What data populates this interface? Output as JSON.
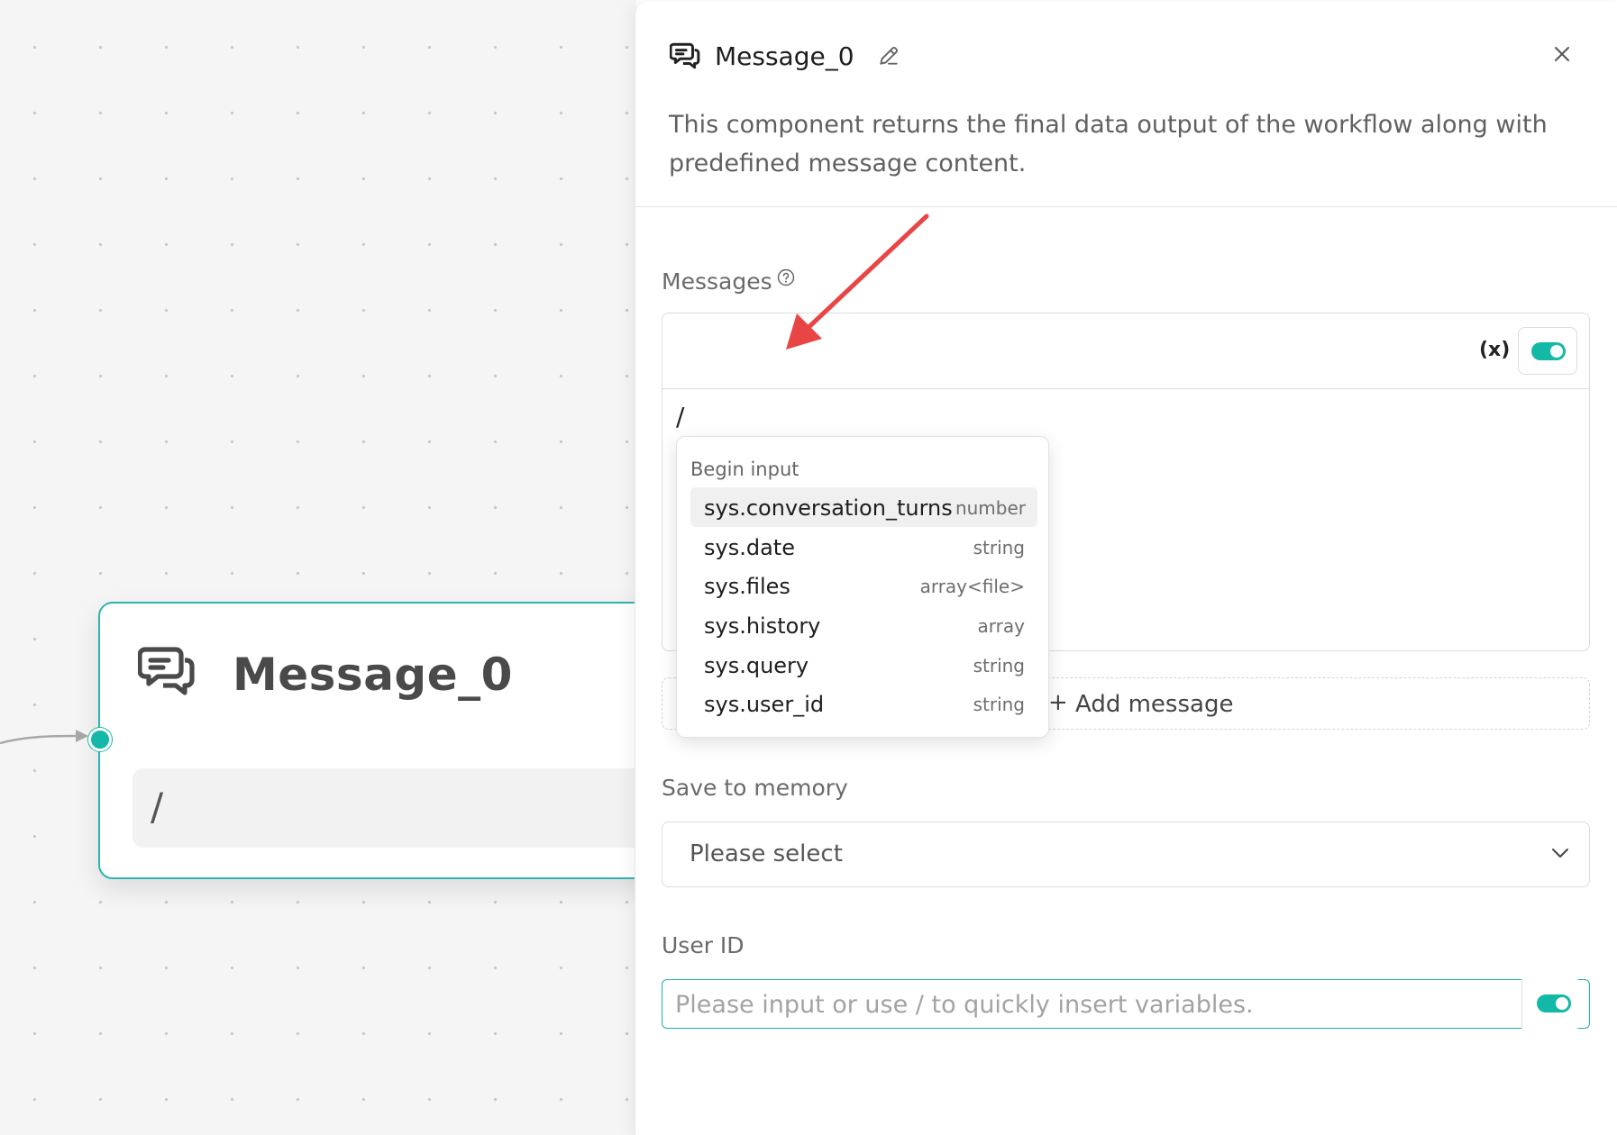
{
  "node": {
    "title": "Message_0",
    "content": "/"
  },
  "drawer": {
    "title": "Message_0",
    "description": "This component returns the final data output of the workflow along with predefined message content.",
    "messages": {
      "label": "Messages",
      "content": "/",
      "variable_icon": "(x)",
      "toggle_on": true
    },
    "add_message_label": "Add message",
    "save_to_memory": {
      "label": "Save to memory",
      "value": "Please select"
    },
    "user_id": {
      "label": "User ID",
      "placeholder": "Please input or use / to quickly insert variables.",
      "toggle_on": true
    }
  },
  "popover": {
    "group_label": "Begin input",
    "items": [
      {
        "name": "sys.conversation_turns",
        "type": "number",
        "active": true
      },
      {
        "name": "sys.date",
        "type": "string"
      },
      {
        "name": "sys.files",
        "type": "array<file>"
      },
      {
        "name": "sys.history",
        "type": "array"
      },
      {
        "name": "sys.query",
        "type": "string"
      },
      {
        "name": "sys.user_id",
        "type": "string"
      }
    ]
  },
  "colors": {
    "accent": "#14b8a6",
    "node_border": "#2fb5ad",
    "annotation_arrow": "#e84545"
  },
  "icons": {
    "message": "chat-bubbles-icon",
    "edit": "pencil-icon",
    "close": "close-icon",
    "help": "question-circle-icon",
    "chevron": "chevron-down-icon"
  }
}
